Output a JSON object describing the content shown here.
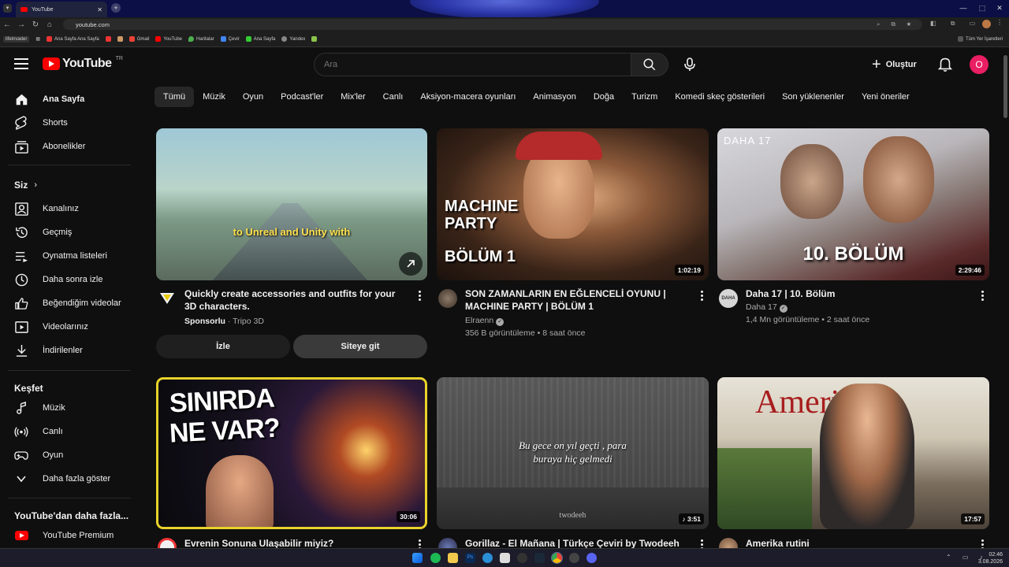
{
  "browser": {
    "tab_title": "YouTube",
    "url": "youtube.com",
    "bookmarks": [
      "Ana Sayfa Ana Sayfa",
      "Gmail",
      "YouTube",
      "Haritalar",
      "Çevir",
      "Ana Sayfa",
      "Yandex"
    ],
    "bookmarks_lead": "lifeinvader",
    "all_bookmarks": "Tüm Yer İşaretleri"
  },
  "header": {
    "logo_text": "YouTube",
    "region": "TR",
    "search_placeholder": "Ara",
    "create_label": "Oluştur",
    "avatar_letter": "O"
  },
  "sidebar": {
    "main": [
      {
        "label": "Ana Sayfa",
        "icon": "home-icon"
      },
      {
        "label": "Shorts",
        "icon": "shorts-icon"
      },
      {
        "label": "Abonelikler",
        "icon": "subscriptions-icon"
      }
    ],
    "you_heading": "Siz",
    "you": [
      {
        "label": "Kanalınız",
        "icon": "channel-icon"
      },
      {
        "label": "Geçmiş",
        "icon": "history-icon"
      },
      {
        "label": "Oynatma listeleri",
        "icon": "playlists-icon"
      },
      {
        "label": "Daha sonra izle",
        "icon": "watch-later-icon"
      },
      {
        "label": "Beğendiğim videolar",
        "icon": "like-icon"
      },
      {
        "label": "Videolarınız",
        "icon": "your-videos-icon"
      },
      {
        "label": "İndirilenler",
        "icon": "download-icon"
      }
    ],
    "explore_heading": "Keşfet",
    "explore": [
      {
        "label": "Müzik",
        "icon": "music-icon"
      },
      {
        "label": "Canlı",
        "icon": "live-icon"
      },
      {
        "label": "Oyun",
        "icon": "gaming-icon"
      },
      {
        "label": "Daha fazla göster",
        "icon": "chevron-down-icon"
      }
    ],
    "more_heading": "YouTube'dan daha fazla...",
    "more": [
      {
        "label": "YouTube Premium",
        "icon": "youtube-premium-icon"
      }
    ]
  },
  "chips": [
    "Tümü",
    "Müzik",
    "Oyun",
    "Podcast'ler",
    "Mix'ler",
    "Canlı",
    "Aksiyon-macera oyunları",
    "Animasyon",
    "Doğa",
    "Turizm",
    "Komedi skeç gösterileri",
    "Son yüklenenler",
    "Yeni öneriler"
  ],
  "videos": [
    {
      "title": "Quickly create accessories and outfits for your 3D characters.",
      "sponsored": "Sponsorlu",
      "channel": "Tripo 3D",
      "overlay": "to Unreal and Unity with",
      "watch_label": "İzle",
      "site_label": "Siteye git"
    },
    {
      "title": "SON ZAMANLARIN EN EĞLENCELİ OYUNU | MACHINE PARTY | BÖLÜM 1",
      "channel": "Elraenn",
      "meta": "356 B görüntüleme • 8 saat önce",
      "duration": "1:02:19",
      "thumb_text_1": "MACHINE PARTY",
      "thumb_text_2": "BÖLÜM 1"
    },
    {
      "title": "Daha 17 | 10. Bölüm",
      "channel": "Daha 17",
      "meta": "1,4 Mn görüntüleme • 2 saat önce",
      "duration": "2:29:46",
      "thumb_text_1": "DAHA 17",
      "thumb_text_2": "10. BÖLÜM"
    },
    {
      "title": "Evrenin Sonuna Ulaşabilir miyiz?",
      "duration": "30:06",
      "thumb_text_1": "SINIRDA",
      "thumb_text_2": "NE VAR?"
    },
    {
      "title": "Gorillaz - El Mañana | Türkçe Çeviri by Twodeeh",
      "duration": "3:51",
      "thumb_text_1": "Bu gece on yıl geçti , para",
      "thumb_text_2": "buraya hiç gelmedi",
      "thumb_text_3": "twodeeh"
    },
    {
      "title": "Amerika rutini",
      "duration": "17:57",
      "thumb_text_1": "America"
    }
  ],
  "taskbar": {
    "time": "02:46",
    "date": "3.08.2026"
  }
}
